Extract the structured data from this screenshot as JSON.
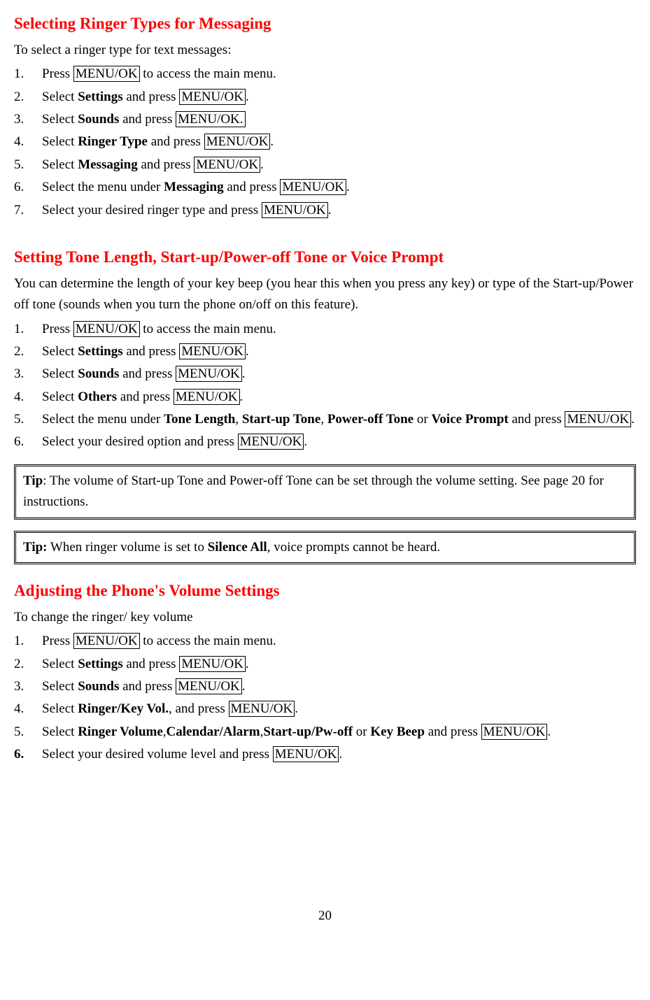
{
  "s1": {
    "title": "Selecting Ringer Types for Messaging",
    "intro": "To select a ringer type for text messages:",
    "items": [
      {
        "pre": "Press ",
        "btn": "MENU/OK",
        "post": " to access the main menu."
      },
      {
        "pre": "Select ",
        "b1": "Settings",
        "mid": " and press ",
        "btn": "MENU/OK",
        "post": "."
      },
      {
        "pre": "Select ",
        "b1": "Sounds",
        "mid": " and press ",
        "btn": "MENU/OK.",
        "post": ""
      },
      {
        "pre": "Select ",
        "b1": "Ringer Type",
        "mid": " and press ",
        "btn": "MENU/OK",
        "post": "."
      },
      {
        "pre": "Select ",
        "b1": "Messaging",
        "mid": " and press ",
        "btn": "MENU/OK",
        "post": "."
      },
      {
        "pre": "Select the menu under ",
        "b1": "Messaging",
        "mid": " and press ",
        "btn": "MENU/OK",
        "post": "."
      },
      {
        "pre": "Select your desired ringer type and press ",
        "btn": "MENU/OK",
        "post": "."
      }
    ]
  },
  "s2": {
    "title": "Setting Tone Length, Start-up/Power-off Tone or Voice Prompt",
    "intro": "You can determine the length of your key beep (you hear this when you press any key) or type of the Start-up/Power off tone (sounds when you turn the phone on/off on this feature).",
    "items": [
      {
        "pre": "Press ",
        "btn": "MENU/OK",
        "post": " to access the main menu."
      },
      {
        "pre": "Select ",
        "b1": "Settings",
        "mid": " and press ",
        "btn": "MENU/OK",
        "post": "."
      },
      {
        "pre": "Select ",
        "b1": "Sounds",
        "mid": " and press ",
        "btn": "MENU/OK",
        "post": "."
      },
      {
        "pre": "Select ",
        "b1": "Others",
        "mid": " and press ",
        "btn": "MENU/OK",
        "post": "."
      },
      {
        "pre": "Select the menu under ",
        "b1": "Tone Length",
        "t1": ", ",
        "b2": "Start-up Tone",
        "t2": ", ",
        "b3": "Power-off Tone",
        "t3": " or ",
        "b4": "Voice Prompt",
        "mid": " and press ",
        "btn": "MENU/OK",
        "post": "."
      },
      {
        "pre": "Select your desired option and press ",
        "btn": "MENU/OK",
        "post": "."
      }
    ]
  },
  "tip1": {
    "label": "Tip",
    "text": ": The volume of Start-up Tone and Power-off Tone can be set through the volume setting. See page 20 for instructions."
  },
  "tip2": {
    "label": "Tip:",
    "t1": " When ringer volume is set to ",
    "b1": "Silence All",
    "t2": ", voice prompts cannot be heard."
  },
  "s3": {
    "title": "Adjusting the Phone's Volume Settings",
    "intro": "To change the ringer/ key volume",
    "items": [
      {
        "pre": "Press ",
        "btn": "MENU/OK",
        "post": " to access the main menu."
      },
      {
        "pre": "Select ",
        "b1": "Settings",
        "mid": " and press ",
        "btn": "MENU/OK",
        "post": "."
      },
      {
        "pre": "Select ",
        "b1": "Sounds",
        "mid": " and press ",
        "btn": "MENU/OK",
        "post": "."
      },
      {
        "pre": "Select ",
        "b1": "Ringer/Key Vol.",
        "mid": ", and press ",
        "btn": "MENU/OK",
        "post": "."
      },
      {
        "pre": "Select ",
        "b1": "Ringer Volume",
        "t1": ",",
        "b2": "Calendar/Alarm",
        "t2": ",",
        "b3": "Start-up/Pw-off",
        "t3": " or ",
        "b4": "Key Beep",
        "mid": " and press ",
        "btn": "MENU/OK",
        "post": "."
      },
      {
        "pre": "Select your desired volume level and press ",
        "btn": "MENU/OK",
        "post": ".",
        "boldNum": true
      }
    ]
  },
  "pageNum": "20"
}
